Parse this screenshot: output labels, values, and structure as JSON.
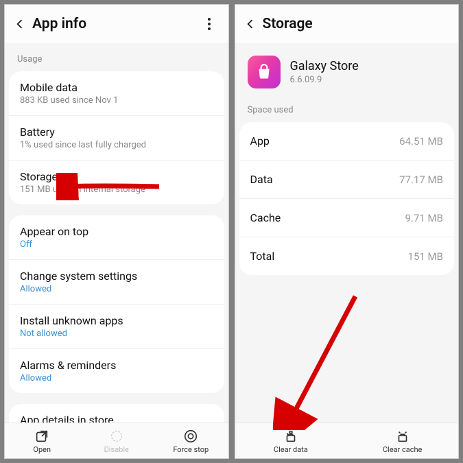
{
  "left": {
    "title": "App info",
    "usage_label": "Usage",
    "rows_usage": [
      {
        "title": "Mobile data",
        "sub": "883 KB used since Nov 1"
      },
      {
        "title": "Battery",
        "sub": "1% used since last fully charged"
      },
      {
        "title": "Storage",
        "sub": "151 MB used in internal storage"
      }
    ],
    "rows_perms": [
      {
        "title": "Appear on top",
        "val": "Off"
      },
      {
        "title": "Change system settings",
        "val": "Allowed"
      },
      {
        "title": "Install unknown apps",
        "val": "Not allowed"
      },
      {
        "title": "Alarms & reminders",
        "val": "Allowed"
      }
    ],
    "rows_details": [
      {
        "title": "App details in store"
      }
    ],
    "actions": {
      "open": "Open",
      "disable": "Disable",
      "forcestop": "Force stop"
    }
  },
  "right": {
    "title": "Storage",
    "app": {
      "name": "Galaxy Store",
      "version": "6.6.09.9"
    },
    "space_label": "Space used",
    "kv": [
      {
        "k": "App",
        "v": "64.51 MB"
      },
      {
        "k": "Data",
        "v": "77.17 MB"
      },
      {
        "k": "Cache",
        "v": "9.71 MB"
      },
      {
        "k": "Total",
        "v": "151 MB"
      }
    ],
    "actions": {
      "cleardata": "Clear data",
      "clearcache": "Clear cache"
    }
  }
}
